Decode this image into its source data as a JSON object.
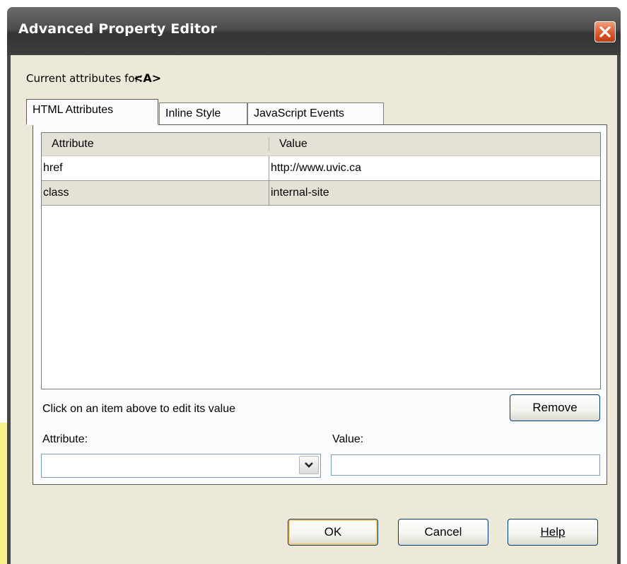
{
  "window": {
    "title": "Advanced Property Editor"
  },
  "header": {
    "current_label": "Current attributes for:",
    "element_tag": "<A>"
  },
  "tabs": [
    {
      "label": "HTML Attributes",
      "active": true
    },
    {
      "label": "Inline Style",
      "active": false
    },
    {
      "label": "JavaScript Events",
      "active": false
    }
  ],
  "grid": {
    "columns": [
      "Attribute",
      "Value"
    ],
    "rows": [
      {
        "attribute": "href",
        "value": "http://www.uvic.ca"
      },
      {
        "attribute": "class",
        "value": "internal-site"
      }
    ]
  },
  "editor": {
    "hint": "Click on an item above to edit its value",
    "remove_label": "Remove",
    "attribute_label": "Attribute:",
    "value_label": "Value:",
    "attribute_value": "",
    "value_value": ""
  },
  "footer": {
    "ok_label": "OK",
    "cancel_label": "Cancel",
    "help_label": "Help"
  },
  "colors": {
    "title_bar": "#454545",
    "dialog_bg": "#ece9d8",
    "close": "#d85a2d",
    "selected_row": "#e4e2d6"
  },
  "icons": {
    "close": "close-icon",
    "dropdown": "chevron-down-icon"
  }
}
